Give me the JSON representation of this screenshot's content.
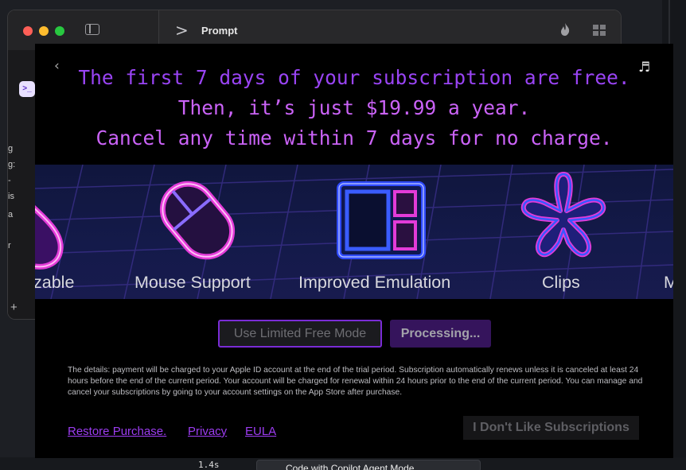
{
  "window": {
    "title": "Prompt"
  },
  "sidebar": {
    "fragments": [
      "g",
      "g:",
      "-",
      "is",
      "a",
      "r"
    ]
  },
  "paywall": {
    "headline": {
      "line1": "The first 7 days of your subscription are free.",
      "line2": "Then, it’s just $19.99 a year.",
      "line3": "Cancel any time within 7 days for no charge."
    },
    "features": [
      {
        "label": "zable",
        "icon": "drop-icon"
      },
      {
        "label": "Mouse Support",
        "icon": "mouse-icon"
      },
      {
        "label": "Improved Emulation",
        "icon": "window-layout-icon"
      },
      {
        "label": "Clips",
        "icon": "asterisk-icon"
      },
      {
        "label": "M",
        "icon": "none"
      }
    ],
    "buttons": {
      "free_mode": "Use Limited Free Mode",
      "processing": "Processing..."
    },
    "details": "The details: payment will be charged to your Apple ID account at the end of the trial period. Subscription automatically renews unless it is canceled at least 24 hours before the end of the current period. Your account will be charged for renewal within 24 hours prior to the end of the current period. You can manage and cancel your subscriptions by going to your account settings on the App Store after purchase.",
    "links": {
      "restore": "Restore Purchase.",
      "privacy": "Privacy",
      "eula": "EULA"
    },
    "no_subscriptions": "I Don't Like Subscriptions"
  },
  "background": {
    "editor_text": "1.4s",
    "tab_label": "Code with Copilot Agent Mode"
  },
  "colors": {
    "accent_purple": "#9a44f5",
    "accent_pink": "#cb63f8",
    "button_border": "#7a2cd6",
    "processing_bg": "#35145c"
  }
}
